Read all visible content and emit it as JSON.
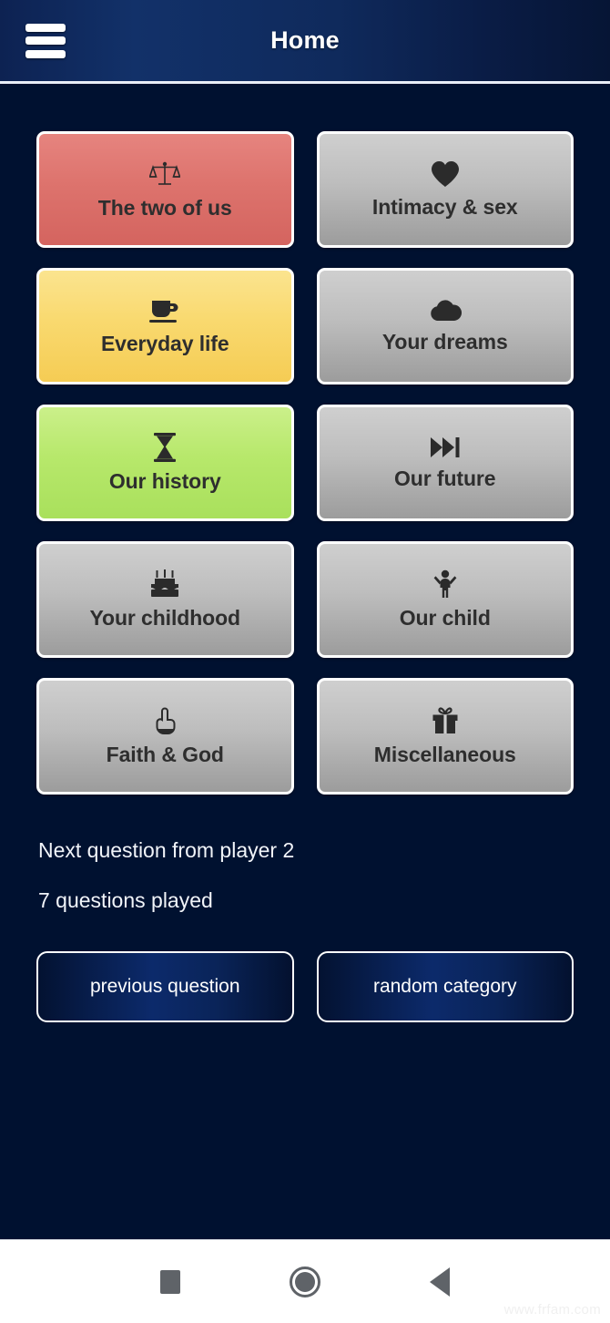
{
  "header": {
    "title": "Home",
    "menu_icon": "hamburger-menu-icon"
  },
  "categories": [
    {
      "label": "The two of us",
      "icon": "balance-scale-icon",
      "color": "red"
    },
    {
      "label": "Intimacy & sex",
      "icon": "heart-icon",
      "color": "grey"
    },
    {
      "label": "Everyday life",
      "icon": "coffee-cup-icon",
      "color": "yellow"
    },
    {
      "label": "Your dreams",
      "icon": "cloud-icon",
      "color": "grey"
    },
    {
      "label": "Our history",
      "icon": "hourglass-icon",
      "color": "green"
    },
    {
      "label": "Our future",
      "icon": "fast-forward-icon",
      "color": "grey"
    },
    {
      "label": "Your childhood",
      "icon": "birthday-cake-icon",
      "color": "grey"
    },
    {
      "label": "Our child",
      "icon": "child-raised-arms-icon",
      "color": "grey"
    },
    {
      "label": "Faith & God",
      "icon": "pointing-up-hand-icon",
      "color": "grey"
    },
    {
      "label": "Miscellaneous",
      "icon": "gift-box-icon",
      "color": "grey"
    }
  ],
  "status": {
    "next_turn": "Next question from player 2",
    "questions_played": "7 questions played"
  },
  "actions": {
    "previous": "previous question",
    "random": "random category"
  },
  "navbar": {
    "recents": "recents-square-icon",
    "home": "home-circle-icon",
    "back": "back-triangle-icon"
  },
  "watermark": "www.frfam.com",
  "colors": {
    "background": "#001130",
    "appbar": "#123169",
    "card_border": "#ffffff",
    "card_red": "#dd736d",
    "card_yellow": "#f9d96f",
    "card_green": "#b7e86b",
    "card_grey": "#bdbdbd",
    "text_dark": "#2e2e2e",
    "text_light": "#ffffff"
  }
}
